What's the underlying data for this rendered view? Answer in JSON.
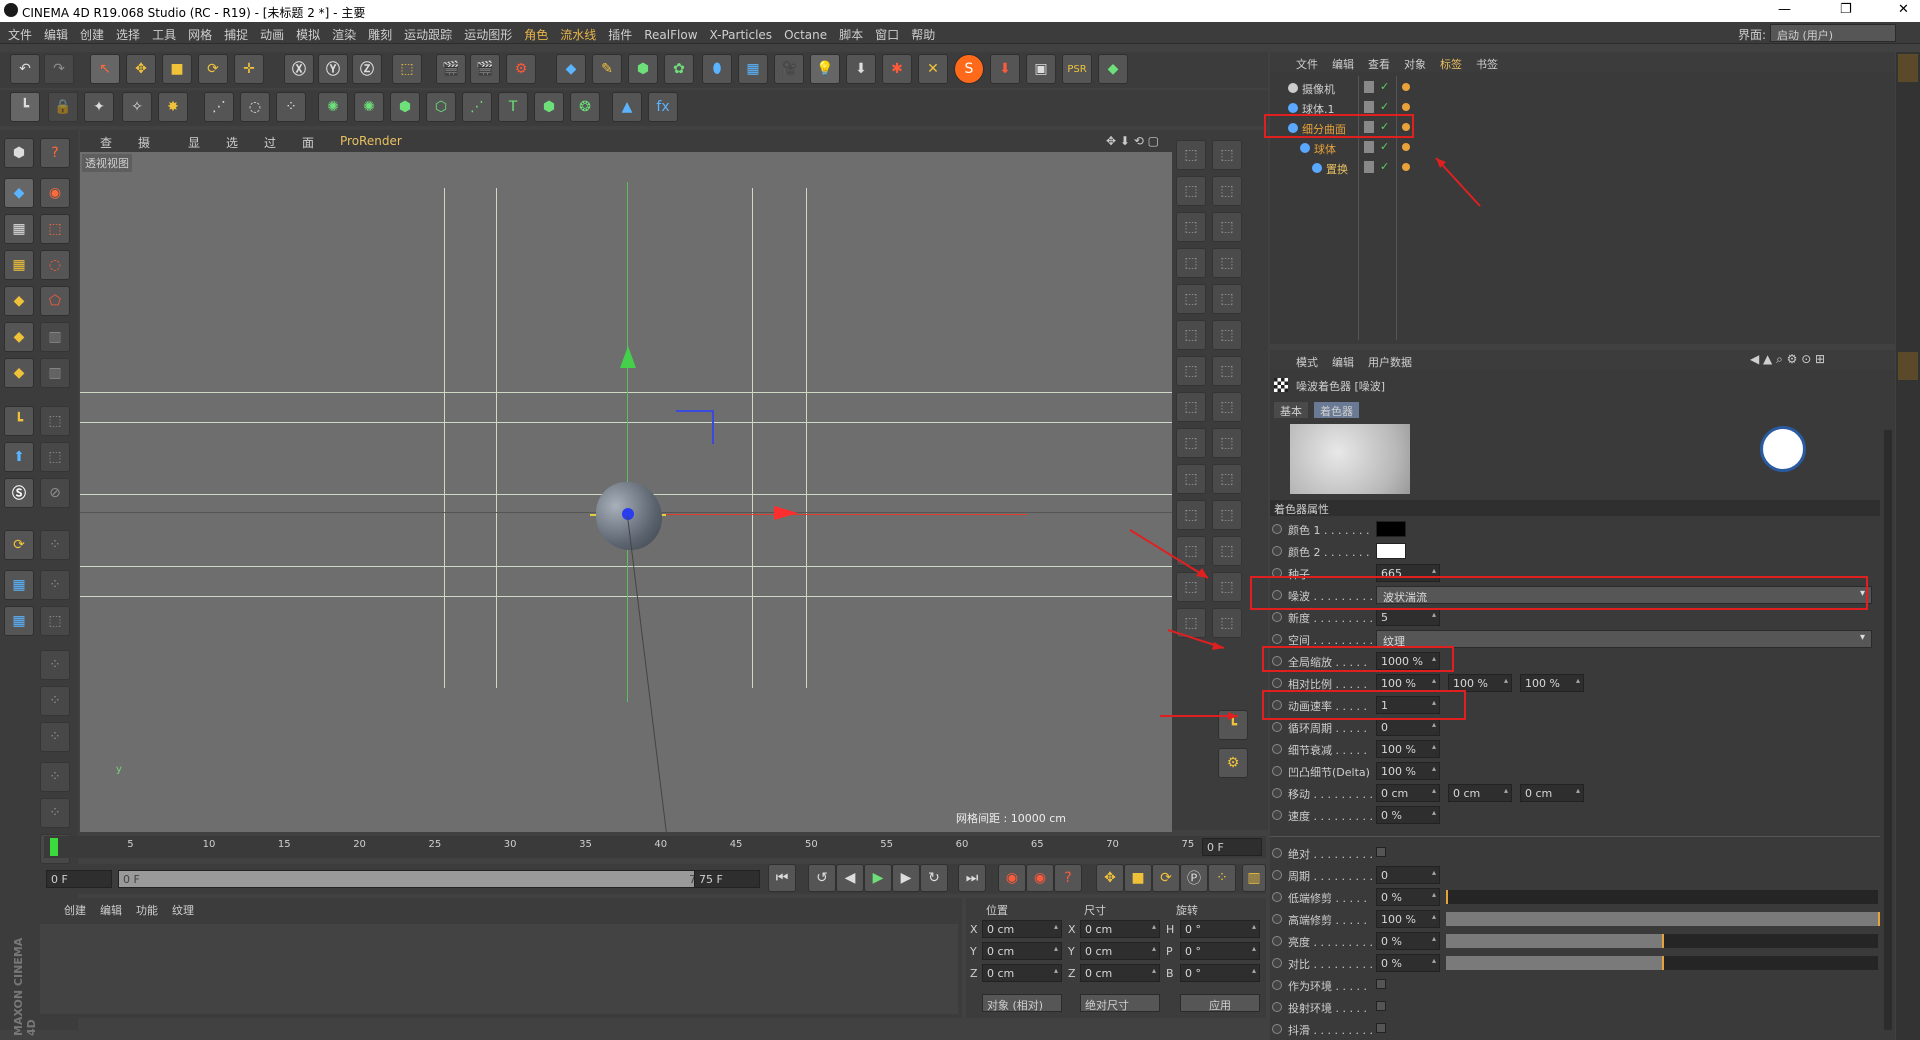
{
  "window": {
    "title": "CINEMA 4D R19.068 Studio (RC - R19) - [未标题 2 *] - 主要"
  },
  "menubar": {
    "items": [
      "文件",
      "编辑",
      "创建",
      "选择",
      "工具",
      "网格",
      "捕捉",
      "动画",
      "模拟",
      "渲染",
      "雕刻",
      "运动跟踪",
      "运动图形",
      "角色",
      "流水线",
      "插件",
      "RealFlow",
      "X-Particles",
      "Octane",
      "脚本",
      "窗口",
      "帮助"
    ],
    "layout_label": "界面:",
    "layout_value": "启动 (用户)"
  },
  "viewport": {
    "menu": [
      "查看",
      "摄像机",
      "显示",
      "选项",
      "过滤",
      "面板",
      "ProRender"
    ],
    "label": "透视视图",
    "grid_spacing": "网格间距 : 10000 cm"
  },
  "timeline": {
    "ticks": [
      "0",
      "5",
      "10",
      "15",
      "20",
      "25",
      "30",
      "35",
      "40",
      "45",
      "50",
      "55",
      "60",
      "65",
      "70",
      "75"
    ],
    "frame_display": "0 F",
    "start": "0 F",
    "range_start": "0 F",
    "range_end": "75 F",
    "end": "75 F"
  },
  "material_panel": {
    "tabs": [
      "创建",
      "编辑",
      "功能",
      "纹理"
    ]
  },
  "coords": {
    "headers": [
      "位置",
      "尺寸",
      "旋转"
    ],
    "rows": [
      {
        "a": "X",
        "p": "0 cm",
        "b": "X",
        "s": "0 cm",
        "c": "H",
        "r": "0 °"
      },
      {
        "a": "Y",
        "p": "0 cm",
        "b": "Y",
        "s": "0 cm",
        "c": "P",
        "r": "0 °"
      },
      {
        "a": "Z",
        "p": "0 cm",
        "b": "Z",
        "s": "0 cm",
        "c": "B",
        "r": "0 °"
      }
    ],
    "mode1": "对象 (相对)",
    "mode2": "绝对尺寸",
    "apply": "应用"
  },
  "objects": {
    "menu": [
      "文件",
      "编辑",
      "查看",
      "对象",
      "标签",
      "书签"
    ],
    "items": [
      {
        "name": "摄像机",
        "indent": 0,
        "color": "#d0d0d0"
      },
      {
        "name": "球体.1",
        "indent": 0,
        "color": "#d0d0d0"
      },
      {
        "name": "细分曲面",
        "indent": 0,
        "color": "#e8a23a"
      },
      {
        "name": "球体",
        "indent": 1,
        "color": "#e8a23a"
      },
      {
        "name": "置换",
        "indent": 2,
        "color": "#e8c060"
      }
    ]
  },
  "attributes": {
    "menu": [
      "模式",
      "编辑",
      "用户数据"
    ],
    "title": "噪波着色器 [噪波]",
    "tabs": [
      "基本",
      "着色器"
    ],
    "section": "着色器属性",
    "rows": [
      {
        "label": "颜色 1 . . . . . . .",
        "type": "color",
        "color": "#000000"
      },
      {
        "label": "颜色 2 . . . . . . .",
        "type": "color",
        "color": "#ffffff"
      },
      {
        "label": "种子 . . . . . . . . .",
        "type": "field",
        "v1": "665"
      },
      {
        "label": "噪波 . . . . . . . . .",
        "type": "dropdown",
        "v1": "波状湍流"
      },
      {
        "label": "新度 . . . . . . . . .",
        "type": "field",
        "v1": "5"
      },
      {
        "label": "空间 . . . . . . . . .",
        "type": "dropdown",
        "v1": "纹理"
      },
      {
        "label": "全局缩放 . . . . .",
        "type": "field",
        "v1": "1000 %"
      },
      {
        "label": "相对比例 . . . . .",
        "type": "triple",
        "v1": "100 %",
        "v2": "100 %",
        "v3": "100 %"
      },
      {
        "label": "动画速率 . . . . .",
        "type": "field",
        "v1": "1"
      },
      {
        "label": "循环周期 . . . . .",
        "type": "field",
        "v1": "0"
      },
      {
        "label": "细节衰减 . . . . .",
        "type": "field",
        "v1": "100 %"
      },
      {
        "label": "凹凸细节(Delta)",
        "type": "field",
        "v1": "100 %"
      },
      {
        "label": "移动 . . . . . . . . .",
        "type": "triple",
        "v1": "0 cm",
        "v2": "0 cm",
        "v3": "0 cm"
      },
      {
        "label": "速度 . . . . . . . . .",
        "type": "field",
        "v1": "0 %"
      },
      {
        "label": "",
        "type": "sep"
      },
      {
        "label": "绝对 . . . . . . . . .",
        "type": "check"
      },
      {
        "label": "周期 . . . . . . . . .",
        "type": "field",
        "v1": "0"
      },
      {
        "label": "低端修剪 . . . . .",
        "type": "slider",
        "v1": "0 %",
        "fill": 0
      },
      {
        "label": "高端修剪 . . . . .",
        "type": "slider",
        "v1": "100 %",
        "fill": 1
      },
      {
        "label": "亮度 . . . . . . . . .",
        "type": "slider",
        "v1": "0 %",
        "fill": 0.5
      },
      {
        "label": "对比 . . . . . . . . .",
        "type": "slider",
        "v1": "0 %",
        "fill": 0.5
      },
      {
        "label": "作为环境 . . . . .",
        "type": "check"
      },
      {
        "label": "投射环境 . . . . .",
        "type": "check"
      },
      {
        "label": "抖滑 . . . . . . . . .",
        "type": "check"
      }
    ]
  },
  "brand": {
    "logo_text": "MAXON CINEMA 4D"
  }
}
